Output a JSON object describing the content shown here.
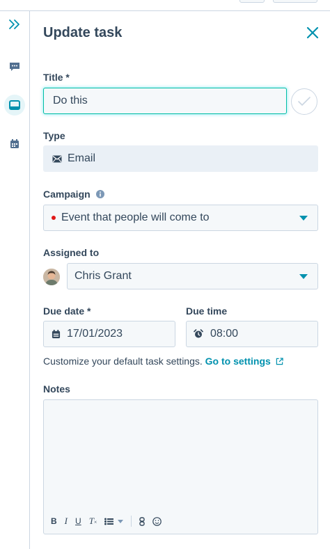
{
  "panel": {
    "title": "Update task",
    "title_field": {
      "label": "Title *",
      "value": "Do this"
    },
    "type_field": {
      "label": "Type",
      "value": "Email"
    },
    "campaign_field": {
      "label": "Campaign",
      "value": "Event that people will come to",
      "dot_color": "#e01818"
    },
    "assigned_field": {
      "label": "Assigned to",
      "value": "Chris Grant"
    },
    "due_date": {
      "label": "Due date *",
      "value": "17/01/2023"
    },
    "due_time": {
      "label": "Due time",
      "value": "08:00"
    },
    "settings_hint": {
      "text": "Customize your default task settings.",
      "link": "Go to settings"
    },
    "notes": {
      "label": "Notes",
      "value": ""
    },
    "toolbar": {
      "bold": "B",
      "italic": "I",
      "underline": "U",
      "clear_format": "T"
    }
  },
  "colors": {
    "accent": "#0091ae",
    "focus": "#00bda5",
    "text": "#33475b",
    "border": "#cbd6e2"
  }
}
